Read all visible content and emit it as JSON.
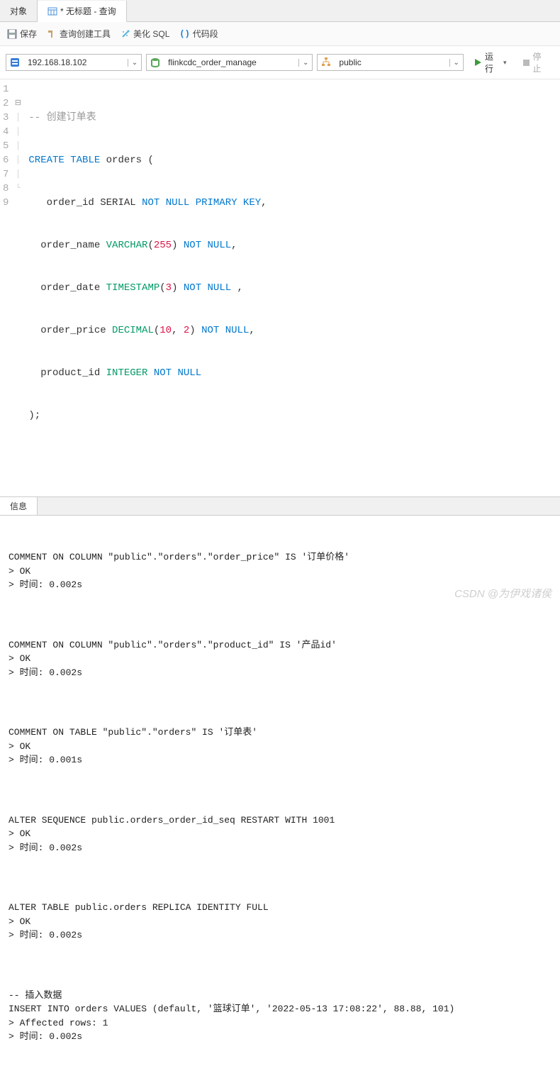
{
  "tabs": {
    "objects": "对象",
    "query": "* 无标题 - 查询"
  },
  "toolbar": {
    "save": "保存",
    "query_builder": "查询创建工具",
    "beautify": "美化 SQL",
    "snippet": "代码段"
  },
  "conn": {
    "host": "192.168.18.102",
    "database": "flinkcdc_order_manage",
    "schema": "public",
    "run": "运行",
    "stop": "停止"
  },
  "code": {
    "l1": "-- 创建订单表",
    "l2a": "CREATE",
    "l2b": "TABLE",
    "l2c": "orders (",
    "l3a": "order_id SERIAL",
    "l3b": "NOT",
    "l3c": "NULL",
    "l3d": "PRIMARY",
    "l3e": "KEY",
    "l4a": "order_name",
    "l4b": "VARCHAR",
    "l4c": "255",
    "l4d": "NOT",
    "l4e": "NULL",
    "l5a": "order_date",
    "l5b": "TIMESTAMP",
    "l5c": "3",
    "l5d": "NOT",
    "l5e": "NULL",
    "l6a": "order_price",
    "l6b": "DECIMAL",
    "l6c": "10",
    "l6d": "2",
    "l6e": "NOT",
    "l6f": "NULL",
    "l7a": "product_id",
    "l7b": "INTEGER",
    "l7c": "NOT",
    "l7d": "NULL",
    "l8": ");"
  },
  "msg_tab": "信息",
  "messages": {
    "b1": "COMMENT ON COLUMN \"public\".\"orders\".\"order_price\" IS '订单价格'\n> OK\n> 时间: 0.002s",
    "b2": "COMMENT ON COLUMN \"public\".\"orders\".\"product_id\" IS '产品id'\n> OK\n> 时间: 0.002s",
    "b3": "COMMENT ON TABLE \"public\".\"orders\" IS '订单表'\n> OK\n> 时间: 0.001s",
    "b4": "ALTER SEQUENCE public.orders_order_id_seq RESTART WITH 1001\n> OK\n> 时间: 0.002s",
    "b5": "ALTER TABLE public.orders REPLICA IDENTITY FULL\n> OK\n> 时间: 0.002s",
    "b6": "-- 插入数据\nINSERT INTO orders VALUES (default, '篮球订单', '2022-05-13 17:08:22', 88.88, 101)\n> Affected rows: 1\n> 时间: 0.002s"
  },
  "watermark": "CSDN @为伊戏诸侯"
}
